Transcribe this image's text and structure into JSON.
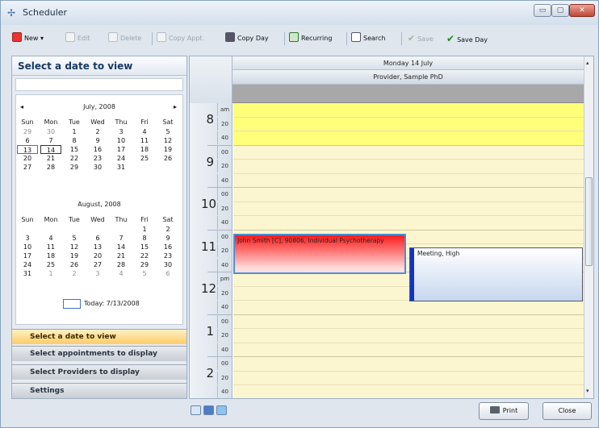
{
  "window": {
    "title": "Scheduler",
    "icon": "scheduler-icon",
    "controls": {
      "minimize": "▭",
      "maximize": "▢",
      "close": "✕"
    }
  },
  "toolbar": {
    "items": [
      {
        "key": "new",
        "label": "New",
        "enabled": true,
        "icon": "new-appointment-icon"
      },
      {
        "key": "edit",
        "label": "Edit",
        "enabled": false,
        "icon": "edit-icon"
      },
      {
        "key": "delete",
        "label": "Delete",
        "enabled": false,
        "icon": "delete-icon"
      },
      {
        "key": "copy_appt",
        "label": "Copy Appt.",
        "enabled": false,
        "icon": "copy-appointment-icon"
      },
      {
        "key": "copy_day",
        "label": "Copy Day",
        "enabled": true,
        "icon": "copy-day-icon"
      },
      {
        "key": "recurring",
        "label": "Recurring",
        "enabled": true,
        "icon": "recurring-icon"
      },
      {
        "key": "search",
        "label": "Search",
        "enabled": true,
        "icon": "search-icon"
      },
      {
        "key": "save",
        "label": "Save",
        "enabled": false,
        "icon": "checkmark-icon"
      },
      {
        "key": "save_day",
        "label": "Save Day",
        "enabled": true,
        "icon": "checkmark-icon"
      }
    ]
  },
  "left_panel": {
    "title": "Select a date to view",
    "calendars": [
      {
        "month": "July, 2008",
        "dow": [
          "Sun",
          "Mon",
          "Tue",
          "Wed",
          "Thu",
          "Fri",
          "Sat"
        ],
        "weeks": [
          [
            "29",
            "30",
            "1",
            "2",
            "3",
            "4",
            "5"
          ],
          [
            "6",
            "7",
            "8",
            "9",
            "10",
            "11",
            "12"
          ],
          [
            "13",
            "14",
            "15",
            "16",
            "17",
            "18",
            "19"
          ],
          [
            "20",
            "21",
            "22",
            "23",
            "24",
            "25",
            "26"
          ],
          [
            "27",
            "28",
            "29",
            "30",
            "31",
            "",
            ""
          ]
        ]
      },
      {
        "month": "August, 2008",
        "dow": [
          "Sun",
          "Mon",
          "Tue",
          "Wed",
          "Thu",
          "Fri",
          "Sat"
        ],
        "weeks": [
          [
            "",
            "",
            "",
            "",
            "",
            "1",
            "2"
          ],
          [
            "3",
            "4",
            "5",
            "6",
            "7",
            "8",
            "9"
          ],
          [
            "10",
            "11",
            "12",
            "13",
            "14",
            "15",
            "16"
          ],
          [
            "17",
            "18",
            "19",
            "20",
            "21",
            "22",
            "23"
          ],
          [
            "24",
            "25",
            "26",
            "27",
            "28",
            "29",
            "30"
          ],
          [
            "31",
            "1",
            "2",
            "3",
            "4",
            "5",
            "6"
          ]
        ]
      }
    ],
    "prev_arrow": "◂",
    "next_arrow": "▸",
    "selected_date": "13",
    "highlighted_date": "14",
    "today_label": "Today: 7/13/2008",
    "nav_buttons": [
      {
        "label": "Select a date to view",
        "active": true
      },
      {
        "label": "Select appointments to display",
        "active": false
      },
      {
        "label": "Select Providers to display",
        "active": false
      },
      {
        "label": "Settings",
        "active": false
      }
    ]
  },
  "schedule": {
    "date_header": "Monday 14 July",
    "provider_header": "Provider, Sample  PhD",
    "time_slots": [
      {
        "hour": "8",
        "marks": [
          "am",
          "20",
          "40"
        ]
      },
      {
        "hour": "9",
        "marks": [
          "00",
          "20",
          "40"
        ]
      },
      {
        "hour": "10",
        "marks": [
          "00",
          "20",
          "40"
        ]
      },
      {
        "hour": "11",
        "marks": [
          "00",
          "20",
          "40"
        ]
      },
      {
        "hour": "12",
        "marks": [
          "pm",
          "20",
          "40"
        ]
      },
      {
        "hour": "1",
        "marks": [
          "00",
          "20",
          "40"
        ]
      },
      {
        "hour": "2",
        "marks": [
          "00",
          "20",
          "40"
        ]
      }
    ],
    "appointments": [
      {
        "text": "John Smith [C], 90806, Individual Psychotherapy",
        "color": "#ff1a1a"
      },
      {
        "text": "Meeting, High",
        "color": "#1134c8"
      }
    ],
    "highlight_color": "#ffff7a",
    "grid_color": "#fbf6d0",
    "scroll": {
      "up": "▴",
      "down": "▾"
    }
  },
  "bottom": {
    "view_icons": [
      "day-view-icon",
      "week-view-icon",
      "month-view-icon"
    ],
    "print_label": "Print",
    "close_label": "Close"
  }
}
